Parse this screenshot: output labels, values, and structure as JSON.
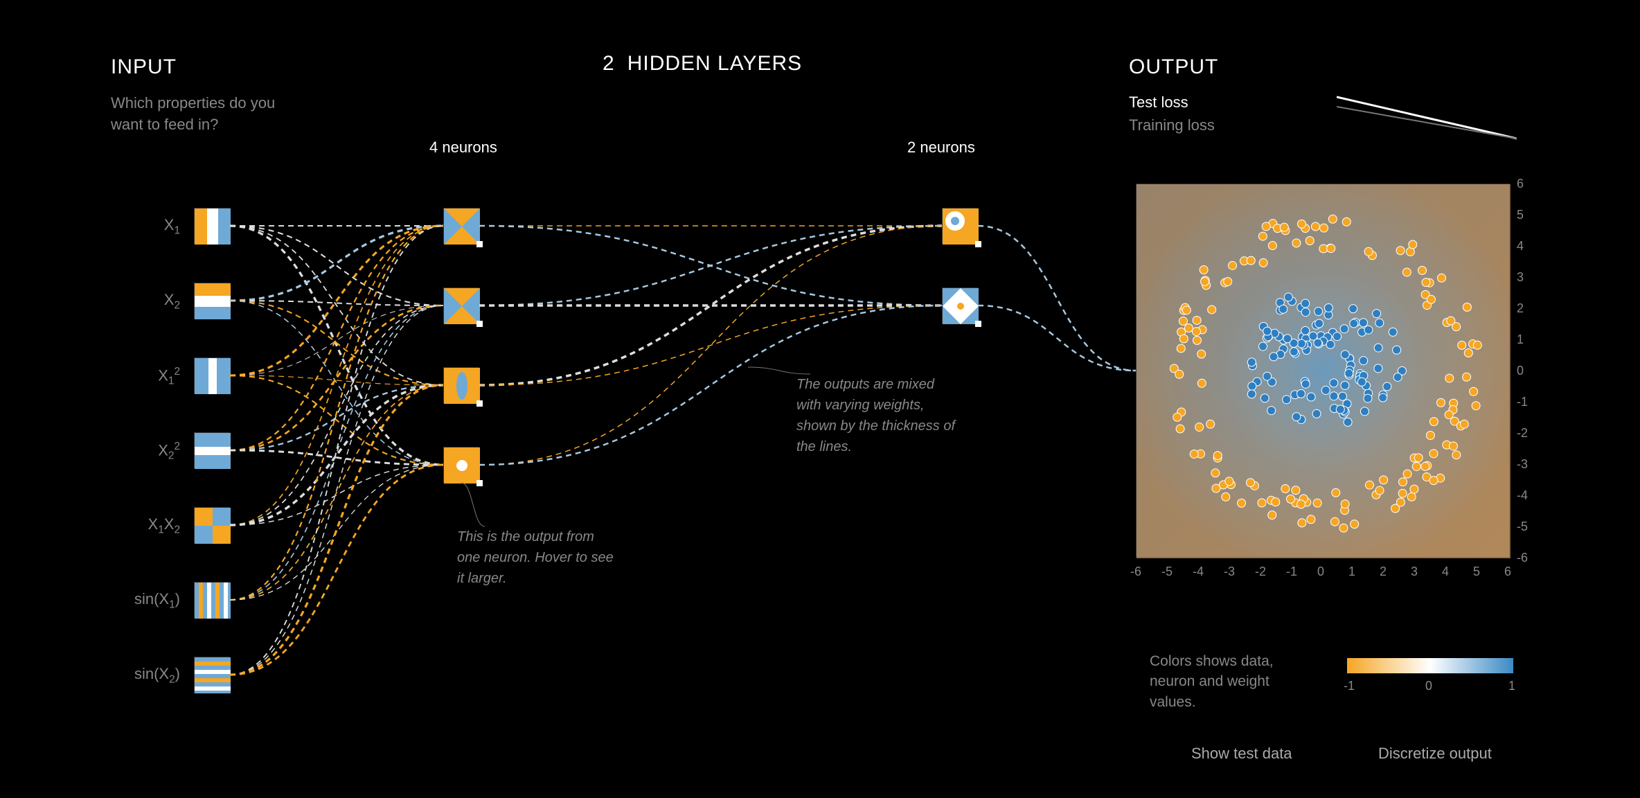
{
  "input": {
    "title": "INPUT",
    "subtitle": "Which properties do you want to feed in?",
    "features": [
      {
        "label_html": "X<sub>1</sub>"
      },
      {
        "label_html": "X<sub>2</sub>"
      },
      {
        "label_html": "X<sub>1</sub><sup>2</sup>"
      },
      {
        "label_html": "X<sub>2</sub><sup>2</sup>"
      },
      {
        "label_html": "X<sub>1</sub>X<sub>2</sub>"
      },
      {
        "label_html": "sin(X<sub>1</sub>)"
      },
      {
        "label_html": "sin(X<sub>2</sub>)"
      }
    ]
  },
  "hidden": {
    "count": "2",
    "title": "HIDDEN LAYERS",
    "layers": [
      {
        "neurons": "4 neurons"
      },
      {
        "neurons": "2 neurons"
      }
    ]
  },
  "hints": {
    "neuron": "This is the output from one neuron. Hover to see it larger.",
    "weights": "The outputs are mixed with varying weights, shown by the thickness of the lines."
  },
  "output": {
    "title": "OUTPUT",
    "test_loss": "Test loss",
    "training_loss": "Training loss",
    "axis_ticks": [
      "-6",
      "-5",
      "-4",
      "-3",
      "-2",
      "-1",
      "0",
      "1",
      "2",
      "3",
      "4",
      "5",
      "6"
    ],
    "colormap_caption": "Colors shows data, neuron and weight values.",
    "colormap_ticks": {
      "min": "-1",
      "mid": "0",
      "max": "1"
    },
    "checkbox_test": "Show test data",
    "checkbox_discretize": "Discretize output"
  },
  "colors": {
    "orange": "#f5a623",
    "blue": "#3b8ac4",
    "light": "#eee"
  }
}
